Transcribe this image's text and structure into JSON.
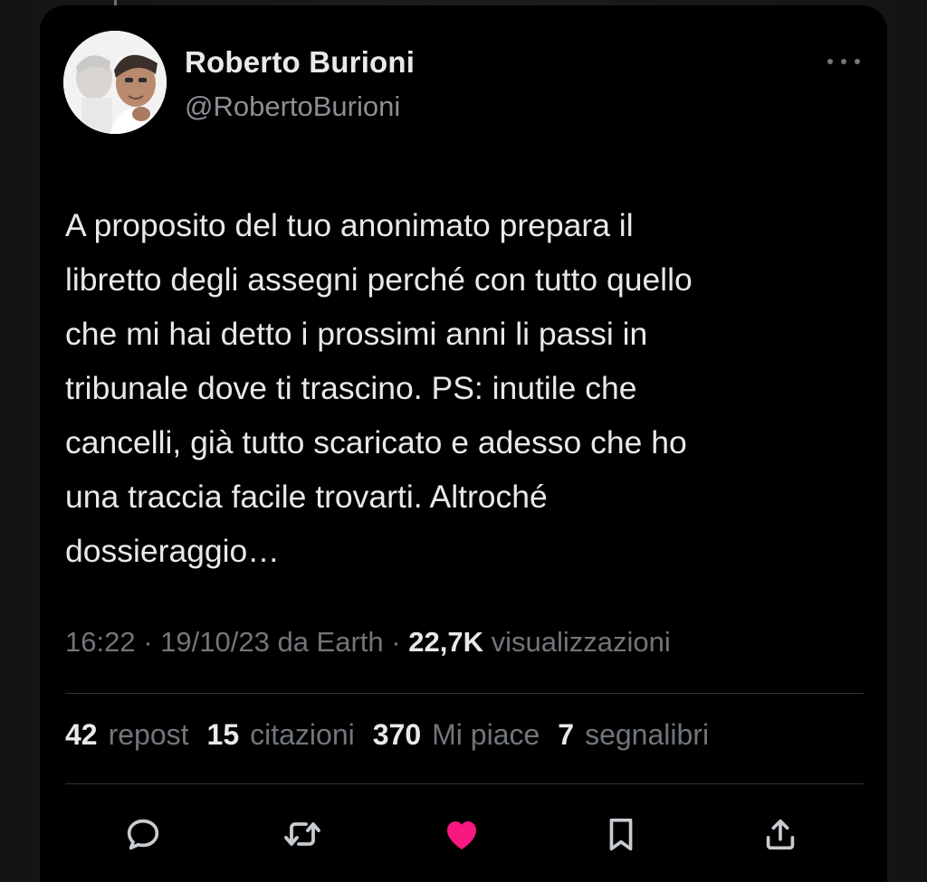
{
  "author": {
    "name": "Roberto Burioni",
    "handle": "@RobertoBurioni"
  },
  "tweet": {
    "text": "A proposito del tuo anonimato prepara il\nlibretto degli assegni perché con tutto quello\nche mi hai detto i prossimi anni li passi in\ntribunale dove ti trascino. PS: inutile che\ncancelli, già tutto scaricato e adesso che ho\nuna traccia facile trovarti. Altroché\ndossieraggio…"
  },
  "meta": {
    "time": "16:22",
    "date": "19/10/23",
    "source": "da Earth",
    "views_count": "22,7K",
    "views_label": "visualizzazioni",
    "separator": "·"
  },
  "stats": {
    "reposts_count": "42",
    "reposts_label": "repost",
    "quotes_count": "15",
    "quotes_label": "citazioni",
    "likes_count": "370",
    "likes_label": "Mi piace",
    "bookmarks_count": "7",
    "bookmarks_label": "segnalibri"
  },
  "icons": {
    "avatar": "avatar-photo",
    "more": "more-icon",
    "reply": "reply-icon",
    "repost": "repost-icon",
    "like": "heart-icon",
    "bookmark": "bookmark-icon",
    "share": "share-icon"
  },
  "colors": {
    "background": "#000000",
    "text_primary": "#e7e9ea",
    "text_secondary": "#71767b",
    "like_active": "#f91880",
    "divider": "#2f3336"
  }
}
